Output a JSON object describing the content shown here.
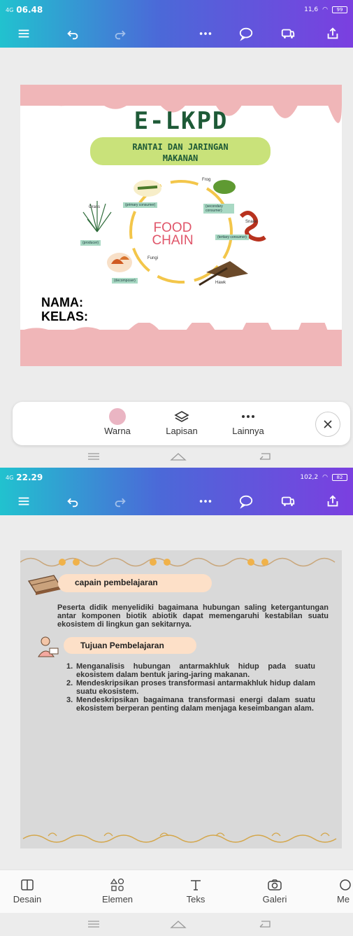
{
  "screen1": {
    "status": {
      "signal": "4G",
      "time": "06.48",
      "right_text": "11,6",
      "battery": "99"
    },
    "document": {
      "title": "E-LKPD",
      "subtitle_line1": "RANTAI DAN JARINGAN",
      "subtitle_line2": "MAKANAN",
      "food_chain_line1": "FOOD",
      "food_chain_line2": "CHAIN",
      "nama_label": "NAMA:",
      "kelas_label": "KELAS:",
      "diagram_labels": {
        "frog": "Frog",
        "grass": "Grass",
        "snake": "Snake",
        "fungi": "Fungi",
        "hawk": "Hawk",
        "primary": "(primary consumer)",
        "secondary": "(secondary consumer)",
        "producer": "(producer)",
        "tertiary": "(tertiary consumer)",
        "decomposer": "(decomposer)"
      }
    },
    "bottom_sheet": {
      "items": [
        {
          "label": "Warna"
        },
        {
          "label": "Lapisan"
        },
        {
          "label": "Lainnya"
        }
      ]
    }
  },
  "screen2": {
    "status": {
      "signal": "4G",
      "time": "22.29",
      "right_text": "102,2",
      "battery": "82"
    },
    "document": {
      "section1_title": "capain pembelajaran",
      "section1_text": "Peserta didik menyelidiki bagaimana hubungan saling ketergantungan antar komponen biotik abiotik dapat memengaruhi kestabilan suatu ekosistem di lingkun gan sekitarnya.",
      "section2_title": "Tujuan Pembelajaran",
      "objectives": [
        {
          "num": "1.",
          "text": "Menganalisis hubungan antarmakhluk hidup pada suatu ekosistem dalam bentuk jaring-jaring makanan."
        },
        {
          "num": "2.",
          "text": "Mendeskripsikan proses transformasi antarmakhluk hidup dalam suatu ekosistem."
        },
        {
          "num": "3.",
          "text": "Mendeskripsikan bagaimana transformasi energi dalam suatu ekosistem berperan penting dalam menjaga keseimbangan alam."
        }
      ]
    },
    "bottom_tabs": [
      {
        "label": "Desain"
      },
      {
        "label": "Elemen"
      },
      {
        "label": "Teks"
      },
      {
        "label": "Galeri"
      },
      {
        "label": "Me"
      }
    ]
  }
}
